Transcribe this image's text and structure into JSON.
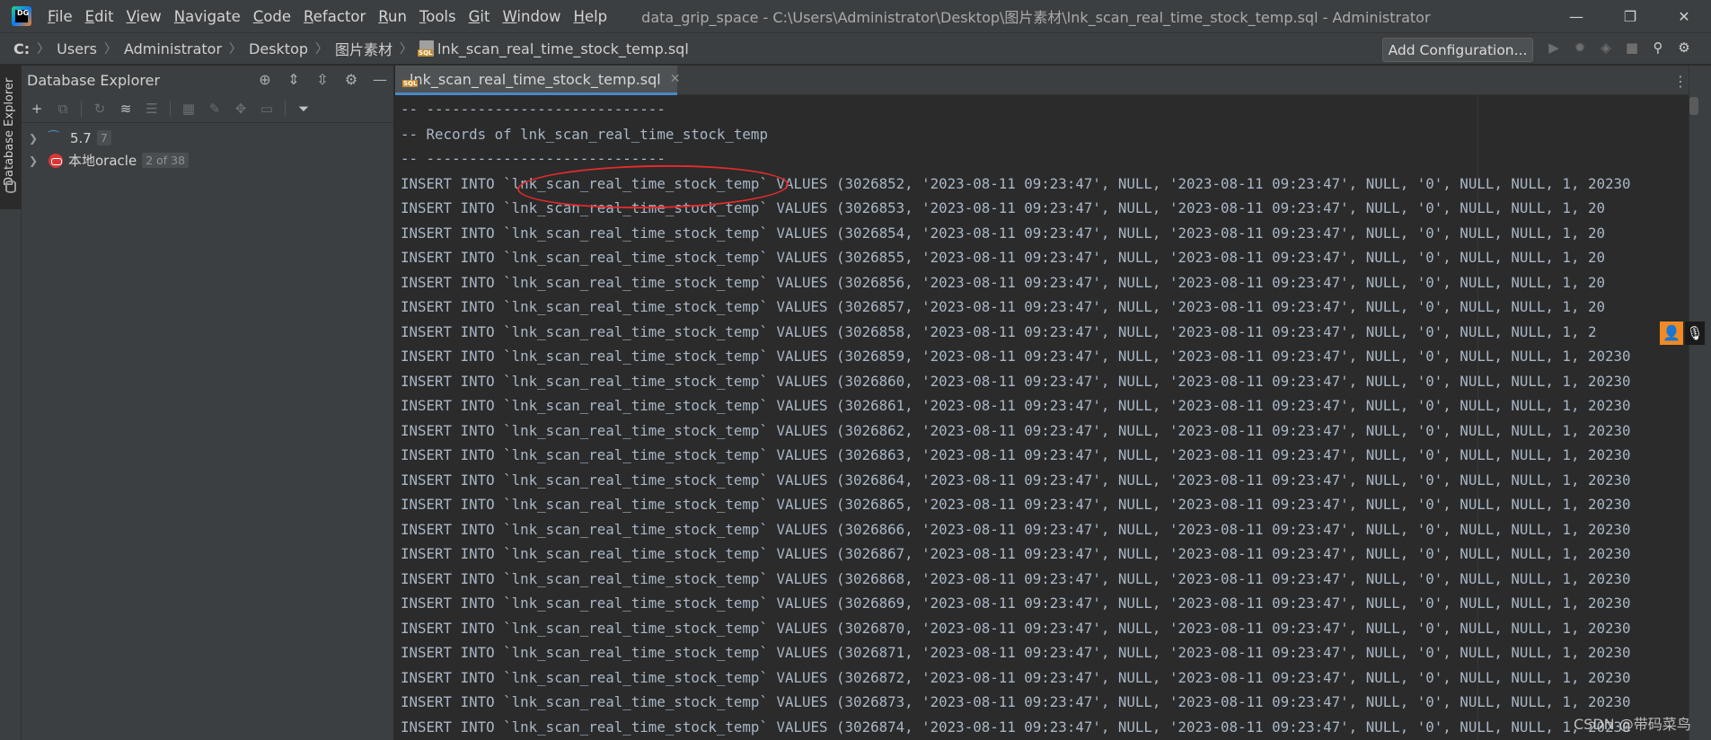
{
  "menubar": {
    "app_logo_text": "DG",
    "items": [
      {
        "label": "File",
        "mnemonic": "F",
        "rest": "ile"
      },
      {
        "label": "Edit",
        "mnemonic": "E",
        "rest": "dit"
      },
      {
        "label": "View",
        "mnemonic": "V",
        "rest": "iew"
      },
      {
        "label": "Navigate",
        "mnemonic": "N",
        "rest": "avigate"
      },
      {
        "label": "Code",
        "mnemonic": "C",
        "rest": "ode"
      },
      {
        "label": "Refactor",
        "mnemonic": "R",
        "rest": "efactor"
      },
      {
        "label": "Run",
        "mnemonic": "R",
        "rest": "un"
      },
      {
        "label": "Tools",
        "mnemonic": "T",
        "rest": "ools"
      },
      {
        "label": "Git",
        "mnemonic": "G",
        "rest": "it"
      },
      {
        "label": "Window",
        "mnemonic": "W",
        "rest": "indow"
      },
      {
        "label": "Help",
        "mnemonic": "H",
        "rest": "elp"
      }
    ],
    "window_title": "data_grip_space - C:\\Users\\Administrator\\Desktop\\图片素材\\lnk_scan_real_time_stock_temp.sql - Administrator",
    "controls": {
      "minimize": "—",
      "restore": "❐",
      "close": "✕"
    }
  },
  "navbar": {
    "breadcrumbs": [
      "C:",
      "Users",
      "Administrator",
      "Desktop",
      "图片素材",
      "lnk_scan_real_time_stock_temp.sql"
    ],
    "add_configuration": "Add Configuration...",
    "icons": [
      "run-icon",
      "debug-icon",
      "coverage-icon",
      "stop-icon",
      "search-icon",
      "settings-icon"
    ]
  },
  "left_stripe": {
    "label": "Database Explorer"
  },
  "db_explorer": {
    "title": "Database Explorer",
    "header_icons": {
      "locate": "⊕",
      "expand": "⇕",
      "collapse": "⇳",
      "settings": "⚙",
      "hide": "—"
    },
    "tree": [
      {
        "label": "5.7",
        "badge": "7",
        "kind": "mysql"
      },
      {
        "label": "本地oracle",
        "badge": "2 of 38",
        "kind": "oracle"
      }
    ]
  },
  "editor": {
    "tab_label": "lnk_scan_real_time_stock_temp.sql",
    "header_lines": [
      "-- ----------------------------",
      "-- Records of lnk_scan_real_time_stock_temp",
      "-- ----------------------------"
    ],
    "insert_lines": [
      "INSERT INTO `lnk_scan_real_time_stock_temp` VALUES (3026852, '2023-08-11 09:23:47', NULL, '2023-08-11 09:23:47', NULL, '0', NULL, NULL, 1, 20230",
      "INSERT INTO `lnk_scan_real_time_stock_temp` VALUES (3026853, '2023-08-11 09:23:47', NULL, '2023-08-11 09:23:47', NULL, '0', NULL, NULL, 1, 20",
      "INSERT INTO `lnk_scan_real_time_stock_temp` VALUES (3026854, '2023-08-11 09:23:47', NULL, '2023-08-11 09:23:47', NULL, '0', NULL, NULL, 1, 20",
      "INSERT INTO `lnk_scan_real_time_stock_temp` VALUES (3026855, '2023-08-11 09:23:47', NULL, '2023-08-11 09:23:47', NULL, '0', NULL, NULL, 1, 20",
      "INSERT INTO `lnk_scan_real_time_stock_temp` VALUES (3026856, '2023-08-11 09:23:47', NULL, '2023-08-11 09:23:47', NULL, '0', NULL, NULL, 1, 20",
      "INSERT INTO `lnk_scan_real_time_stock_temp` VALUES (3026857, '2023-08-11 09:23:47', NULL, '2023-08-11 09:23:47', NULL, '0', NULL, NULL, 1, 20",
      "INSERT INTO `lnk_scan_real_time_stock_temp` VALUES (3026858, '2023-08-11 09:23:47', NULL, '2023-08-11 09:23:47', NULL, '0', NULL, NULL, 1, 2",
      "INSERT INTO `lnk_scan_real_time_stock_temp` VALUES (3026859, '2023-08-11 09:23:47', NULL, '2023-08-11 09:23:47', NULL, '0', NULL, NULL, 1, 20230",
      "INSERT INTO `lnk_scan_real_time_stock_temp` VALUES (3026860, '2023-08-11 09:23:47', NULL, '2023-08-11 09:23:47', NULL, '0', NULL, NULL, 1, 20230",
      "INSERT INTO `lnk_scan_real_time_stock_temp` VALUES (3026861, '2023-08-11 09:23:47', NULL, '2023-08-11 09:23:47', NULL, '0', NULL, NULL, 1, 20230",
      "INSERT INTO `lnk_scan_real_time_stock_temp` VALUES (3026862, '2023-08-11 09:23:47', NULL, '2023-08-11 09:23:47', NULL, '0', NULL, NULL, 1, 20230",
      "INSERT INTO `lnk_scan_real_time_stock_temp` VALUES (3026863, '2023-08-11 09:23:47', NULL, '2023-08-11 09:23:47', NULL, '0', NULL, NULL, 1, 20230",
      "INSERT INTO `lnk_scan_real_time_stock_temp` VALUES (3026864, '2023-08-11 09:23:47', NULL, '2023-08-11 09:23:47', NULL, '0', NULL, NULL, 1, 20230",
      "INSERT INTO `lnk_scan_real_time_stock_temp` VALUES (3026865, '2023-08-11 09:23:47', NULL, '2023-08-11 09:23:47', NULL, '0', NULL, NULL, 1, 20230",
      "INSERT INTO `lnk_scan_real_time_stock_temp` VALUES (3026866, '2023-08-11 09:23:47', NULL, '2023-08-11 09:23:47', NULL, '0', NULL, NULL, 1, 20230",
      "INSERT INTO `lnk_scan_real_time_stock_temp` VALUES (3026867, '2023-08-11 09:23:47', NULL, '2023-08-11 09:23:47', NULL, '0', NULL, NULL, 1, 20230",
      "INSERT INTO `lnk_scan_real_time_stock_temp` VALUES (3026868, '2023-08-11 09:23:47', NULL, '2023-08-11 09:23:47', NULL, '0', NULL, NULL, 1, 20230",
      "INSERT INTO `lnk_scan_real_time_stock_temp` VALUES (3026869, '2023-08-11 09:23:47', NULL, '2023-08-11 09:23:47', NULL, '0', NULL, NULL, 1, 20230",
      "INSERT INTO `lnk_scan_real_time_stock_temp` VALUES (3026870, '2023-08-11 09:23:47', NULL, '2023-08-11 09:23:47', NULL, '0', NULL, NULL, 1, 20230",
      "INSERT INTO `lnk_scan_real_time_stock_temp` VALUES (3026871, '2023-08-11 09:23:47', NULL, '2023-08-11 09:23:47', NULL, '0', NULL, NULL, 1, 20230",
      "INSERT INTO `lnk_scan_real_time_stock_temp` VALUES (3026872, '2023-08-11 09:23:47', NULL, '2023-08-11 09:23:47', NULL, '0', NULL, NULL, 1, 20230",
      "INSERT INTO `lnk_scan_real_time_stock_temp` VALUES (3026873, '2023-08-11 09:23:47', NULL, '2023-08-11 09:23:47', NULL, '0', NULL, NULL, 1, 20230",
      "INSERT INTO `lnk_scan_real_time_stock_temp` VALUES (3026874, '2023-08-11 09:23:47', NULL, '2023-08-11 09:23:47', NULL, '0', NULL, NULL, 1, 20230"
    ]
  },
  "watermark": "CSDN @带码菜鸟",
  "colors": {
    "chrome_bg": "#3c3f41",
    "editor_bg": "#2b2b2b",
    "code_fg": "#a9b7c6",
    "annotation_red": "#e52b2b",
    "tab_underline": "#4a88c7"
  }
}
